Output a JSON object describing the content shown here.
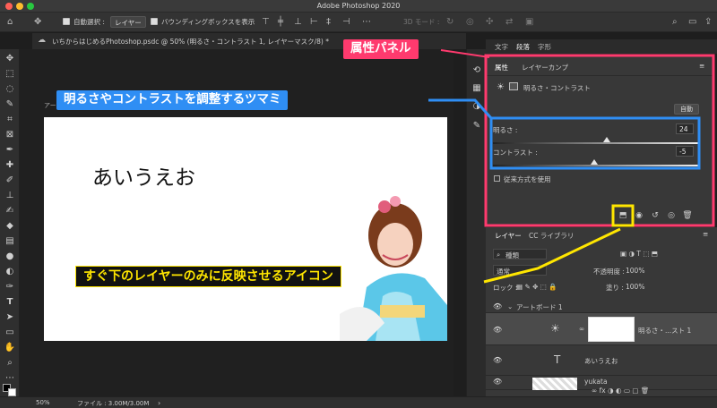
{
  "window": {
    "title": "Adobe Photoshop 2020"
  },
  "options_bar": {
    "auto_select_label": "自動選択 :",
    "auto_select_target": "レイヤー",
    "show_bbox_label": "バウンディングボックスを表示",
    "mode_3d_label": "3D モード :"
  },
  "document_tab": {
    "label": "いちからはじめるPhotoshop.psdc @ 50% (明るさ・コントラスト 1, レイヤーマスク/8) *"
  },
  "canvas": {
    "artboard_label": "アートボード 1",
    "artboard_text": "あいうえお"
  },
  "status_bar": {
    "zoom": "50%",
    "file_info": "ファイル : 3.00M/3.00M"
  },
  "panels_top": {
    "tabs": [
      "文字",
      "段落",
      "字形"
    ]
  },
  "properties_panel": {
    "tabs": [
      "属性",
      "レイヤーカンプ"
    ],
    "adjustment_name": "明るさ・コントラスト",
    "auto_button": "自動",
    "brightness_label": "明るさ :",
    "brightness_value": "24",
    "brightness_fraction": 0.55,
    "contrast_label": "コントラスト :",
    "contrast_value": "-5",
    "contrast_fraction": 0.49,
    "legacy_label": "従来方式を使用"
  },
  "layers_panel": {
    "tabs": [
      "レイヤー",
      "CC ライブラリ"
    ],
    "filter_kind": "種類",
    "blend_mode": "通常",
    "opacity_label": "不透明度 :",
    "opacity_value": "100%",
    "lock_label": "ロック :",
    "fill_label": "塗り :",
    "fill_value": "100%",
    "group_name": "アートボード 1",
    "layers": [
      {
        "name": "明るさ・...スト 1"
      },
      {
        "name": "あいうえお"
      },
      {
        "name": "yukata"
      }
    ]
  },
  "annotations": {
    "properties_panel_label": "属性パネル",
    "slider_label": "明るさやコントラストを調整するツマミ",
    "clip_icon_label": "すぐ下のレイヤーのみに反映させるアイコン"
  },
  "colors": {
    "pink": "#ff3a6e",
    "blue": "#2f8ef4",
    "yellow": "#ffe600",
    "panel_bg": "#383838"
  }
}
